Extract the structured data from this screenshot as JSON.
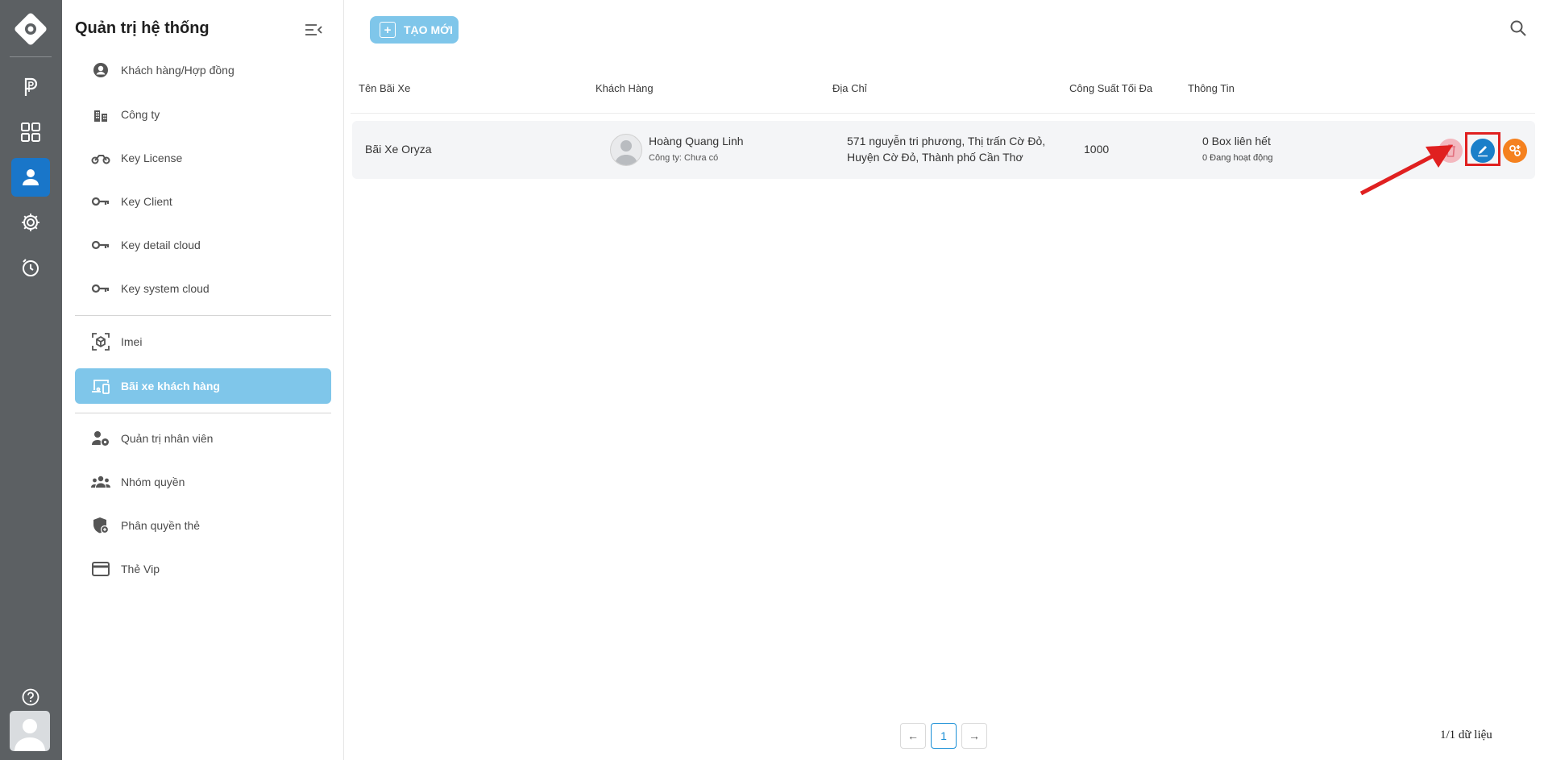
{
  "sidebar": {
    "title": "Quản trị hệ thống",
    "items": [
      {
        "label": "Khách hàng/Hợp đồng",
        "icon": "account-circle-icon"
      },
      {
        "label": "Công ty",
        "icon": "building-icon"
      },
      {
        "label": "Key License",
        "icon": "motorbike-icon"
      },
      {
        "label": "Key Client",
        "icon": "key-icon"
      },
      {
        "label": "Key detail cloud",
        "icon": "key-icon"
      },
      {
        "label": "Key system cloud",
        "icon": "key-icon"
      },
      {
        "label": "Imei",
        "icon": "cube-scan-icon"
      },
      {
        "label": "Bãi xe khách hàng",
        "icon": "devices-icon"
      },
      {
        "label": "Quản trị nhân viên",
        "icon": "user-gear-icon"
      },
      {
        "label": "Nhóm quyền",
        "icon": "group-icon"
      },
      {
        "label": "Phân quyền thẻ",
        "icon": "shield-icon"
      },
      {
        "label": "Thẻ Vip",
        "icon": "credit-card-icon"
      }
    ]
  },
  "toolbar": {
    "new_label": "TẠO MỚI"
  },
  "table": {
    "headers": [
      "Tên Bãi Xe",
      "Khách Hàng",
      "Địa Chỉ",
      "Công Suất Tối Đa",
      "Thông Tin"
    ],
    "rows": [
      {
        "name": "Bãi Xe Oryza",
        "customer_name": "Hoàng Quang Linh",
        "customer_company": "Công ty: Chưa có",
        "address_line1": "571 nguyễn tri phương, Thị trấn Cờ Đỏ,",
        "address_line2": "Huyện Cờ Đỏ, Thành phố Cần Thơ",
        "capacity": "1000",
        "info_line1": "0 Box liên hết",
        "info_line2": "0 Đang hoạt động"
      }
    ]
  },
  "pagination": {
    "current": "1",
    "count_text": "1/1 dữ liệu"
  },
  "colors": {
    "accent": "#7fc6ea",
    "rail": "#5c6063",
    "active_rail": "#1976c9",
    "delete": "#f3b8bf",
    "edit": "#1a7fc9",
    "extra": "#f5811f",
    "highlight": "#e02020"
  }
}
